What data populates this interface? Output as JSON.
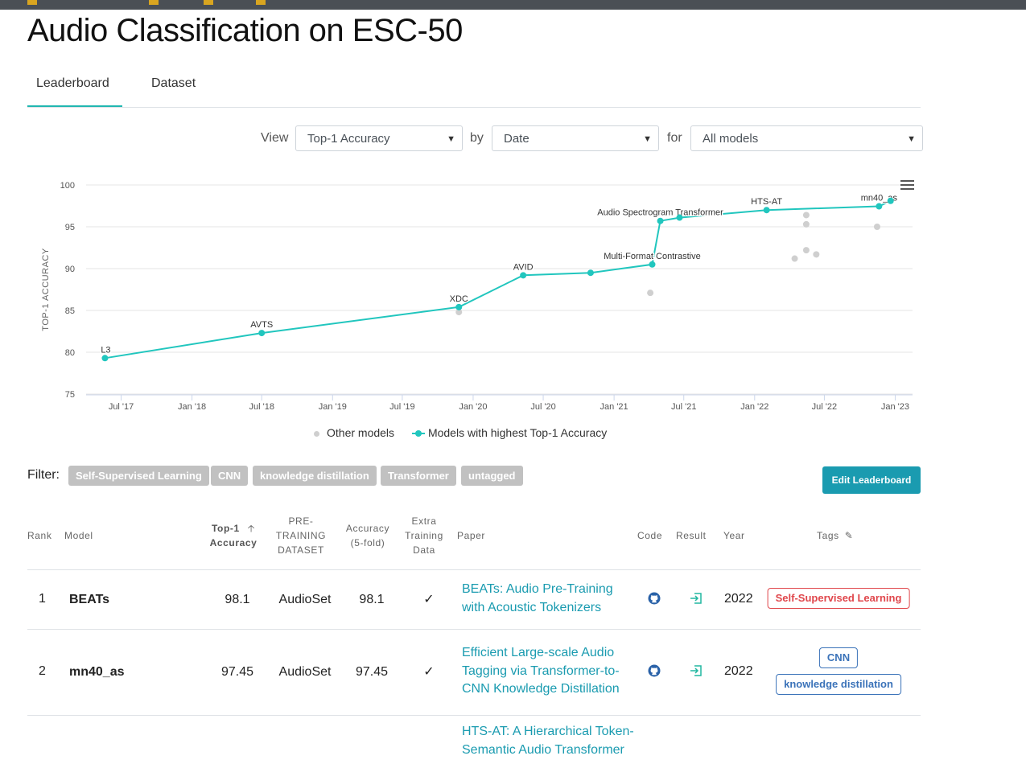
{
  "page": {
    "title": "Audio Classification on ESC-50"
  },
  "tabs": [
    {
      "label": "Leaderboard",
      "active": true
    },
    {
      "label": "Dataset",
      "active": false
    }
  ],
  "controls": {
    "view_label": "View",
    "view_value": "Top-1 Accuracy",
    "by_label": "by",
    "by_value": "Date",
    "for_label": "for",
    "for_value": "All models"
  },
  "chart_data": {
    "type": "scatter",
    "title": "",
    "ylabel": "TOP-1 ACCURACY",
    "ylim": [
      75,
      100
    ],
    "yticks": [
      75,
      80,
      85,
      90,
      95,
      100
    ],
    "x_domain": [
      "2017-04-01",
      "2023-02-15"
    ],
    "xticks": [
      {
        "label": "Jul '17",
        "date": "2017-07-01"
      },
      {
        "label": "Jan '18",
        "date": "2018-01-01"
      },
      {
        "label": "Jul '18",
        "date": "2018-07-01"
      },
      {
        "label": "Jan '19",
        "date": "2019-01-01"
      },
      {
        "label": "Jul '19",
        "date": "2019-07-01"
      },
      {
        "label": "Jan '20",
        "date": "2020-01-01"
      },
      {
        "label": "Jul '20",
        "date": "2020-07-01"
      },
      {
        "label": "Jan '21",
        "date": "2021-01-01"
      },
      {
        "label": "Jul '21",
        "date": "2021-07-01"
      },
      {
        "label": "Jan '22",
        "date": "2022-01-01"
      },
      {
        "label": "Jul '22",
        "date": "2022-07-01"
      },
      {
        "label": "Jan '23",
        "date": "2023-01-01"
      }
    ],
    "grid": true,
    "legend_position": "bottom",
    "series": [
      {
        "name": "Models with highest Top-1 Accuracy",
        "color": "#21c6be",
        "points": [
          {
            "date": "2017-05-20",
            "y": 79.3,
            "label": "L3"
          },
          {
            "date": "2018-07-01",
            "y": 82.3,
            "label": "AVTS"
          },
          {
            "date": "2019-11-25",
            "y": 85.4,
            "label": "XDC"
          },
          {
            "date": "2020-05-10",
            "y": 89.2,
            "label": "AVID"
          },
          {
            "date": "2020-11-01",
            "y": 89.5,
            "label": ""
          },
          {
            "date": "2021-04-10",
            "y": 90.5,
            "label": "Multi-Format Contrastive"
          },
          {
            "date": "2021-05-01",
            "y": 95.7,
            "label": "Audio Spectrogram Transformer"
          },
          {
            "date": "2021-06-20",
            "y": 96.1,
            "label": ""
          },
          {
            "date": "2022-02-01",
            "y": 97.0,
            "label": "HTS-AT"
          },
          {
            "date": "2022-11-20",
            "y": 97.45,
            "label": "mn40_as"
          },
          {
            "date": "2022-12-20",
            "y": 98.1,
            "label": ""
          }
        ]
      },
      {
        "name": "Other models",
        "color": "#cfcfcf",
        "points": [
          {
            "date": "2019-11-25",
            "y": 84.8
          },
          {
            "date": "2021-04-05",
            "y": 87.1
          },
          {
            "date": "2022-04-15",
            "y": 91.2
          },
          {
            "date": "2022-05-15",
            "y": 96.4
          },
          {
            "date": "2022-05-15",
            "y": 95.3
          },
          {
            "date": "2022-05-15",
            "y": 92.2
          },
          {
            "date": "2022-06-10",
            "y": 91.7
          },
          {
            "date": "2022-11-15",
            "y": 95.0
          }
        ]
      }
    ]
  },
  "legend": {
    "other": "Other models",
    "best": "Models with highest Top-1 Accuracy"
  },
  "filter": {
    "label": "Filter:",
    "tags": [
      "Self-Supervised Learning",
      "CNN",
      "knowledge distillation",
      "Transformer",
      "untagged"
    ]
  },
  "edit_button": "Edit Leaderboard",
  "table": {
    "headers": {
      "rank": "Rank",
      "model": "Model",
      "top1_line1": "Top-1",
      "top1_line2": "Accuracy",
      "pre_line1": "PRE-",
      "pre_line2": "TRAINING",
      "pre_line3": "DATASET",
      "acc_line1": "Accuracy",
      "acc_line2": "(5-fold)",
      "extra_line1": "Extra",
      "extra_line2": "Training",
      "extra_line3": "Data",
      "paper": "Paper",
      "code": "Code",
      "result": "Result",
      "year": "Year",
      "tags": "Tags"
    },
    "rows": [
      {
        "rank": "1",
        "model": "BEATs",
        "top1": "98.1",
        "pretraining": "AudioSet",
        "acc5fold": "98.1",
        "extra": "✓",
        "paper": [
          "BEATs: Audio Pre-Training",
          "with Acoustic Tokenizers"
        ],
        "year": "2022",
        "tags": [
          "Self-Supervised Learning"
        ]
      },
      {
        "rank": "2",
        "model": "mn40_as",
        "top1": "97.45",
        "pretraining": "AudioSet",
        "acc5fold": "97.45",
        "extra": "✓",
        "paper": [
          "Efficient Large-scale Audio",
          "Tagging via Transformer-to-",
          "CNN Knowledge Distillation"
        ],
        "year": "2022",
        "tags": [
          "CNN",
          "knowledge distillation"
        ]
      },
      {
        "rank": "",
        "model": "",
        "top1": "",
        "pretraining": "",
        "acc5fold": "",
        "extra": "",
        "paper": [
          "HTS-AT: A Hierarchical Token-",
          "Semantic Audio Transformer"
        ],
        "year": "",
        "tags": []
      }
    ]
  }
}
